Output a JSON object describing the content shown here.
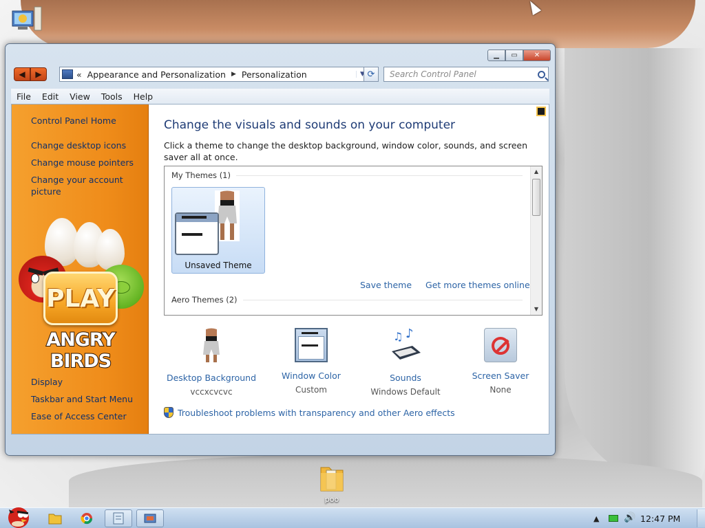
{
  "desktop": {
    "icons": [
      {
        "label": "poo"
      }
    ]
  },
  "window": {
    "address": {
      "parts": [
        "Appearance and Personalization",
        "Personalization"
      ],
      "overflow_glyph": "«"
    },
    "search": {
      "placeholder": "Search Control Panel"
    },
    "menu": [
      "File",
      "Edit",
      "View",
      "Tools",
      "Help"
    ],
    "sidebar": {
      "links": [
        "Control Panel Home",
        "Change desktop icons",
        "Change mouse pointers",
        "Change your account picture"
      ],
      "see_also_links": [
        "Display",
        "Taskbar and Start Menu",
        "Ease of Access Center"
      ],
      "art_text": {
        "play": "PLAY",
        "logo": "ANGRY BIRDS"
      }
    },
    "main": {
      "title": "Change the visuals and sounds on your computer",
      "subtitle": "Click a theme to change the desktop background, window color, sounds, and screen saver all at once.",
      "themes": {
        "my_themes_header": "My Themes (1)",
        "tile_label": "Unsaved Theme",
        "save_link": "Save theme",
        "more_link": "Get more themes online",
        "aero_header": "Aero Themes (2)"
      },
      "options": [
        {
          "label": "Desktop Background",
          "value": "vccxcvcvc",
          "icon": "desktop-background-icon"
        },
        {
          "label": "Window Color",
          "value": "Custom",
          "icon": "window-color-icon"
        },
        {
          "label": "Sounds",
          "value": "Windows Default",
          "icon": "sounds-icon"
        },
        {
          "label": "Screen Saver",
          "value": "None",
          "icon": "screen-saver-icon"
        }
      ],
      "troubleshoot": "Troubleshoot problems with transparency and other Aero effects"
    }
  },
  "taskbar": {
    "time": "12:47 PM"
  },
  "colors": {
    "sidebar": "#ef8c1a",
    "link": "#2d64a6",
    "title": "#1e3b75"
  }
}
